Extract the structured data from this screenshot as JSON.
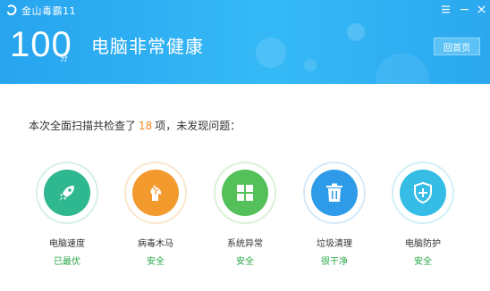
{
  "app": {
    "logo_text": "金山毒霸11"
  },
  "header": {
    "score": "100",
    "score_unit": "分",
    "status_title": "电脑非常健康",
    "home_button": "回首页"
  },
  "summary": {
    "prefix": "本次全面扫描共检查了",
    "count": "18",
    "suffix": "项，未发现问题："
  },
  "colors": {
    "header_accent": "#2ba8ef",
    "count_orange": "#f08a24",
    "ok_green": "#28a745"
  },
  "items": [
    {
      "label": "电脑速度",
      "result": "已最优",
      "icon": "rocket-icon",
      "color": "#2fb88f",
      "ring": "#d4f0e6"
    },
    {
      "label": "病毒木马",
      "result": "安全",
      "icon": "horse-icon",
      "color": "#f39a2e",
      "ring": "#fbe6cc"
    },
    {
      "label": "系统异常",
      "result": "安全",
      "icon": "windows-icon",
      "color": "#53c05a",
      "ring": "#d9f1d6"
    },
    {
      "label": "垃圾清理",
      "result": "很干净",
      "icon": "trash-icon",
      "color": "#2d9be8",
      "ring": "#d3e9fa"
    },
    {
      "label": "电脑防护",
      "result": "安全",
      "icon": "shield-plus-icon",
      "color": "#35bde6",
      "ring": "#d2eff8"
    }
  ]
}
